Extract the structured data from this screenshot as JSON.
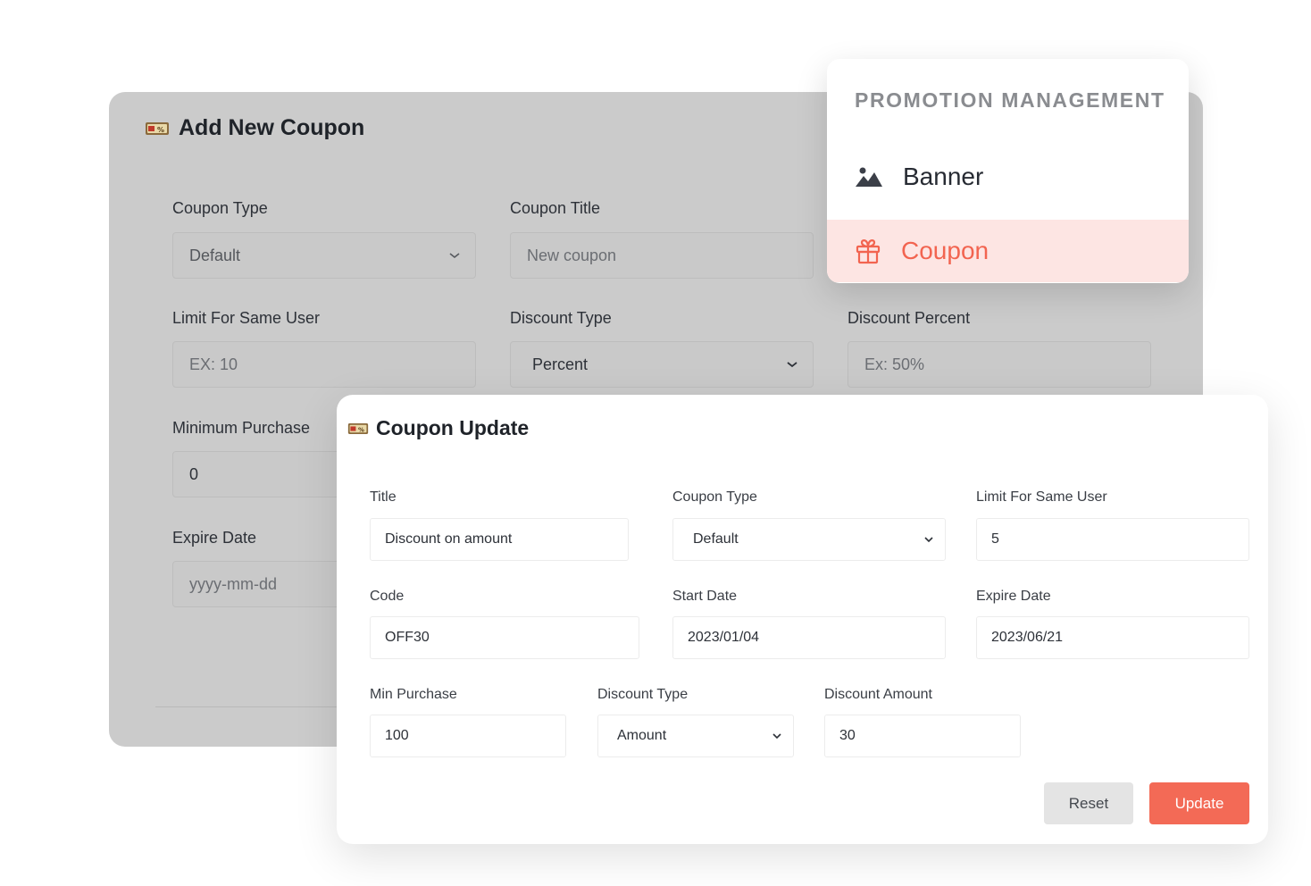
{
  "add_coupon": {
    "title": "Add New Coupon",
    "coupon_type_label": "Coupon Type",
    "coupon_type_value": "Default",
    "coupon_title_label": "Coupon Title",
    "coupon_title_placeholder": "New coupon",
    "limit_label": "Limit For Same User",
    "limit_placeholder": "EX: 10",
    "discount_type_label": "Discount Type",
    "discount_type_value": "Percent",
    "discount_percent_label": "Discount Percent",
    "discount_percent_placeholder": "Ex: 50%",
    "min_purchase_label": "Minimum Purchase",
    "min_purchase_value": "0",
    "expire_label": "Expire Date",
    "expire_placeholder": "yyyy-mm-dd"
  },
  "menu": {
    "heading": "PROMOTION MANAGEMENT",
    "items": [
      {
        "label": "Banner",
        "icon": "image-icon",
        "active": false
      },
      {
        "label": "Coupon",
        "icon": "gift-icon",
        "active": true
      }
    ],
    "active_color": "#f26450"
  },
  "coupon_update": {
    "title": "Coupon Update",
    "title_label": "Title",
    "title_value": "Discount on amount",
    "coupon_type_label": "Coupon Type",
    "coupon_type_value": "Default",
    "limit_label": "Limit For Same User",
    "limit_value": "5",
    "code_label": "Code",
    "code_value": "OFF30",
    "start_label": "Start Date",
    "start_value": "2023/01/04",
    "expire_label": "Expire Date",
    "expire_value": "2023/06/21",
    "min_purchase_label": "Min Purchase",
    "min_purchase_value": "100",
    "discount_type_label": "Discount Type",
    "discount_type_value": "Amount",
    "discount_amount_label": "Discount Amount",
    "discount_amount_value": "30",
    "reset_label": "Reset",
    "update_label": "Update"
  },
  "colors": {
    "accent": "#f36a56",
    "backdrop": "#cbcbcb"
  }
}
